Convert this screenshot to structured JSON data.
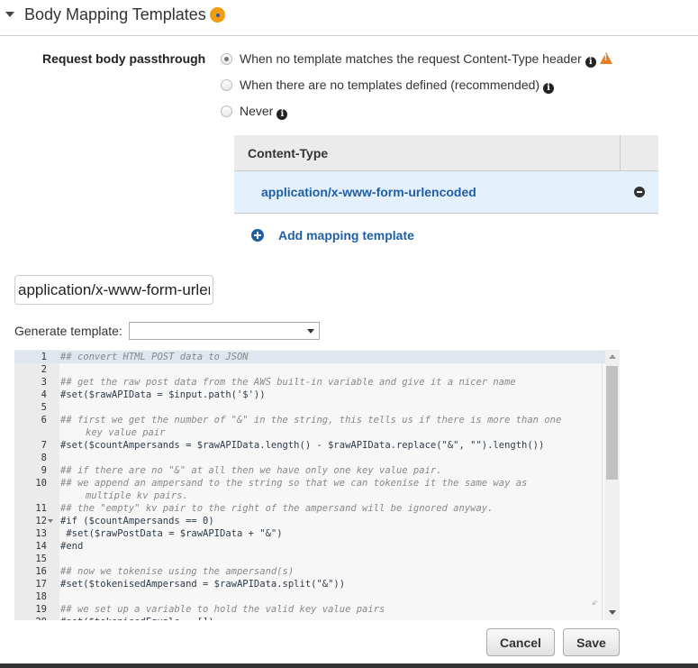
{
  "section": {
    "title": "Body Mapping Templates"
  },
  "passthrough": {
    "label": "Request body passthrough",
    "options": [
      {
        "label": "When no template matches the request Content-Type header",
        "selected": true,
        "info": true,
        "warning": true
      },
      {
        "label": "When there are no templates defined (recommended)",
        "selected": false,
        "info": true
      },
      {
        "label": "Never",
        "selected": false,
        "info": true
      }
    ]
  },
  "content_types": {
    "header": "Content-Type",
    "rows": [
      "application/x-www-form-urlencoded"
    ],
    "add_label": "Add mapping template"
  },
  "content_type_input": {
    "value": "application/x-www-form-urlencoded"
  },
  "generate": {
    "label": "Generate template:",
    "value": ""
  },
  "editor": {
    "lines": [
      {
        "n": "1",
        "text": "## convert HTML POST data to JSON"
      },
      {
        "n": "2",
        "text": ""
      },
      {
        "n": "3",
        "text": "## get the raw post data from the AWS built-in variable and give it a nicer name"
      },
      {
        "n": "4",
        "text": "#set($rawAPIData = $input.path('$'))"
      },
      {
        "n": "5",
        "text": ""
      },
      {
        "n": "6",
        "text": "## first we get the number of \"&\" in the string, this tells us if there is more than one",
        "wrap": "key value pair"
      },
      {
        "n": "7",
        "text": "#set($countAmpersands = $rawAPIData.length() - $rawAPIData.replace(\"&\", \"\").length())"
      },
      {
        "n": "8",
        "text": ""
      },
      {
        "n": "9",
        "text": "## if there are no \"&\" at all then we have only one key value pair."
      },
      {
        "n": "10",
        "text": "## we append an ampersand to the string so that we can tokenise it the same way as",
        "wrap": "multiple kv pairs."
      },
      {
        "n": "11",
        "text": "## the \"empty\" kv pair to the right of the ampersand will be ignored anyway."
      },
      {
        "n": "12",
        "text": "#if ($countAmpersands == 0)",
        "fold": true
      },
      {
        "n": "13",
        "text": " #set($rawPostData = $rawAPIData + \"&\")"
      },
      {
        "n": "14",
        "text": "#end"
      },
      {
        "n": "15",
        "text": ""
      },
      {
        "n": "16",
        "text": "## now we tokenise using the ampersand(s)"
      },
      {
        "n": "17",
        "text": "#set($tokenisedAmpersand = $rawAPIData.split(\"&\"))"
      },
      {
        "n": "18",
        "text": ""
      },
      {
        "n": "19",
        "text": "## we set up a variable to hold the valid key value pairs"
      },
      {
        "n": "20",
        "text": "#set($tokenisedEquals = [])"
      }
    ]
  },
  "buttons": {
    "cancel": "Cancel",
    "save": "Save"
  }
}
